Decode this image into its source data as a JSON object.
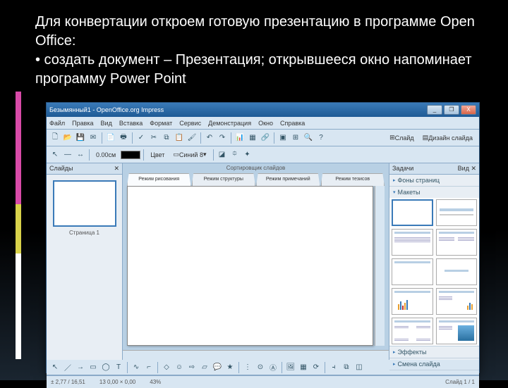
{
  "slide": {
    "line1": "     Для конвертации откроем готовую презентацию в программе Open Office:",
    "line2": "•  создать документ – Презентация; открывшееся окно напоминает программу Power Point"
  },
  "window": {
    "title": "Безымянный1 - OpenOffice.org Impress",
    "controls": {
      "min": "_",
      "max": "❐",
      "close": "X"
    }
  },
  "menubar": [
    "Файл",
    "Правка",
    "Вид",
    "Вставка",
    "Формат",
    "Сервис",
    "Демонстрация",
    "Окно",
    "Справка"
  ],
  "toolbar2": {
    "line_label": "0.00см",
    "color_label": "Цвет",
    "color_name": "Синий 8",
    "slide_btn": "Слайд",
    "design_btn": "Дизайн слайда"
  },
  "panels": {
    "slides_title": "Слайды",
    "slide_num": "Страница 1",
    "tasks_title": "Задачи",
    "tasks_view": "Вид ✕"
  },
  "center": {
    "sort_label": "Сортировщик слайдов",
    "tabs": [
      "Режим рисования",
      "Режим структуры",
      "Режим примечаний",
      "Режим тезисов"
    ]
  },
  "tasks": {
    "sections": [
      "Фоны страниц",
      "Макеты",
      "Эффекты",
      "Смена слайда"
    ]
  },
  "statusbar": {
    "pos": "± 2,77 / 16,51",
    "size": "13 0,00 × 0,00",
    "zoom": "43%",
    "page": "Слайд 1 / 1"
  }
}
